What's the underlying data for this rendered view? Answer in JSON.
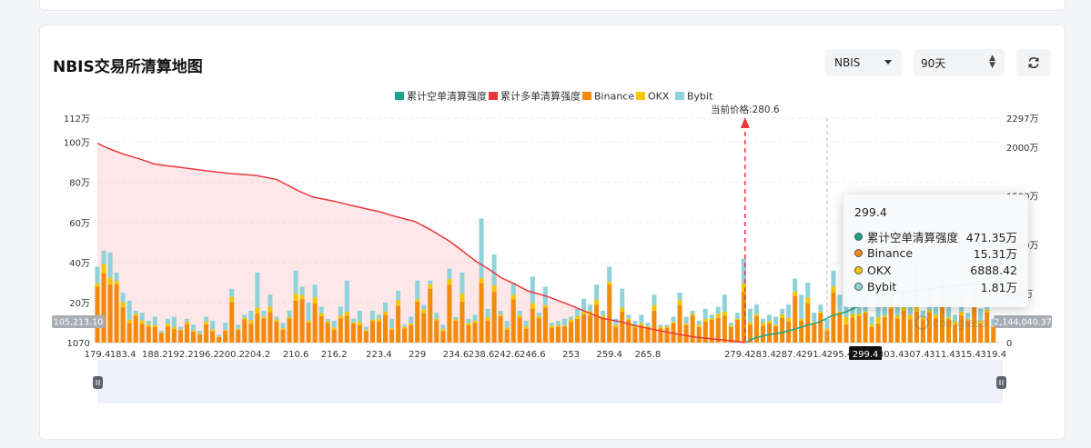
{
  "header": {
    "title": "NBIS交易所清算地图",
    "symbol_select": "NBIS",
    "period_select": "90天"
  },
  "icons": {
    "dropdown": "caret-down-icon",
    "stepper": "up-down-icon",
    "refresh": "refresh-icon"
  },
  "colors": {
    "short_cum": "#1aa48a",
    "long_cum": "#e8383d",
    "binance": "#f28b0c",
    "okx": "#f7c600",
    "bybit": "#8fd3da",
    "price_line": "#e8383d"
  },
  "chart_data": {
    "type": "bar",
    "legend": [
      "累计空单清算强度",
      "累计多单清算强度",
      "Binance",
      "OKX",
      "Bybit"
    ],
    "legend_position": "top-center",
    "current_price_label": "当前价格:280.6",
    "current_price": 280.6,
    "x_range": [
      179.4,
      321
    ],
    "x_ticks": [
      "179.4",
      "183.4",
      "188.2",
      "192.2",
      "196.2",
      "200.2",
      "204.2",
      "210.6",
      "216.2",
      "223.4",
      "229",
      "234.6",
      "238.6",
      "242.6",
      "246.6",
      "253",
      "259.4",
      "265.8",
      "279.4",
      "283.4",
      "287.4",
      "291.4",
      "295.4",
      "299.4",
      "303.4",
      "307.4",
      "311.4",
      "315.4",
      "319.4"
    ],
    "x_tick_values": [
      179.4,
      183.4,
      188.2,
      192.2,
      196.2,
      200.2,
      204.2,
      210.6,
      216.2,
      223.4,
      229,
      234.6,
      238.6,
      242.6,
      246.6,
      253,
      259.4,
      265.8,
      279.4,
      283.4,
      287.4,
      291.4,
      295.4,
      299.4,
      303.4,
      307.4,
      311.4,
      315.4,
      319.4
    ],
    "x_tick_indices": [
      0,
      4,
      9,
      13,
      17,
      21,
      25,
      31,
      37,
      44,
      50,
      56,
      60,
      64,
      68,
      74,
      80,
      86,
      100,
      104,
      108,
      112,
      116,
      120,
      124,
      128,
      132,
      136,
      140
    ],
    "highlight_x": "299.4",
    "left_axis": {
      "ticks": [
        "1070",
        "20万",
        "40万",
        "60万",
        "80万",
        "100万",
        "112万"
      ],
      "tick_values": [
        1070,
        200000,
        400000,
        600000,
        800000,
        1000000,
        1120000
      ],
      "ylim": [
        1070,
        1120000
      ],
      "edge_label": "105,213.10"
    },
    "right_axis": {
      "ticks": [
        "0",
        "500万",
        "1000万",
        "1500万",
        "2000万",
        "2297万"
      ],
      "tick_values": [
        0,
        5000000,
        10000000,
        15000000,
        20000000,
        22970000
      ],
      "ylim": [
        0,
        22970000
      ],
      "edge_label": "2,144,040.37"
    },
    "grid": true,
    "bars": {
      "okx_share_min": 0.04,
      "okx_share_max": 0.12,
      "bybit_share": [
        0.22,
        0.15,
        0.28,
        0.12,
        0.19,
        0.45,
        0.1,
        0.26,
        0.18,
        0.33,
        0.14,
        0.22,
        0.4,
        0.16,
        0.12,
        0.3,
        0.25,
        0.18,
        0.4,
        0.2,
        0.35,
        0.15,
        0.22,
        0.12,
        0.3,
        0.5,
        0.18,
        0.25,
        0.1,
        0.28,
        0.2,
        0.32,
        0.15,
        0.45,
        0.22,
        0.18,
        0.12,
        0.3,
        0.24,
        0.5,
        0.16,
        0.35,
        0.2,
        0.28,
        0.14,
        0.22,
        0.4,
        0.18,
        0.12,
        0.26,
        0.3,
        0.12,
        0.06,
        0.2,
        0.24,
        0.14,
        0.1,
        0.3,
        0.18,
        0.22,
        0.48,
        0.25,
        0.35,
        0.12,
        0.3,
        0.2,
        0.15,
        0.25,
        0.4,
        0.12,
        0.33,
        0.15,
        0.2,
        0.28,
        0.1,
        0.22,
        0.3,
        0.17,
        0.26,
        0.15,
        0.2,
        0.25,
        0.35,
        0.14,
        0.2,
        0.3,
        0.16,
        0.22,
        0.12,
        0.1,
        0.2,
        0.15,
        0.25,
        0.1,
        0.18,
        0.3,
        0.12,
        0.2,
        0.35,
        0.15,
        0.2,
        0.3,
        0.4,
        0.25,
        0.18,
        0.22,
        0.3,
        0.16,
        0.35,
        0.2,
        0.5,
        0.25,
        0.3,
        0.18,
        0.4,
        0.22,
        0.35,
        0.6,
        0.28,
        0.2,
        0.35,
        0.3,
        0.7,
        0.25,
        0.4,
        0.25,
        0.35,
        0.3,
        0.5,
        0.2,
        0.4,
        0.22,
        0.35,
        0.3,
        0.25,
        0.4,
        0.2,
        0.3,
        0.35,
        0.25,
        0.3,
        0.2,
        0.25
      ],
      "total": [
        380000,
        460000,
        450000,
        350000,
        250000,
        210000,
        160000,
        150000,
        110000,
        130000,
        60000,
        120000,
        130000,
        80000,
        120000,
        90000,
        60000,
        130000,
        110000,
        40000,
        100000,
        270000,
        90000,
        140000,
        160000,
        350000,
        160000,
        240000,
        130000,
        100000,
        160000,
        360000,
        280000,
        200000,
        290000,
        180000,
        120000,
        110000,
        180000,
        310000,
        120000,
        160000,
        80000,
        160000,
        140000,
        200000,
        120000,
        260000,
        90000,
        130000,
        310000,
        190000,
        310000,
        150000,
        90000,
        370000,
        130000,
        350000,
        120000,
        140000,
        620000,
        170000,
        440000,
        160000,
        110000,
        300000,
        160000,
        110000,
        330000,
        150000,
        280000,
        100000,
        110000,
        120000,
        130000,
        170000,
        220000,
        190000,
        290000,
        160000,
        380000,
        120000,
        270000,
        140000,
        110000,
        140000,
        100000,
        240000,
        90000,
        90000,
        130000,
        250000,
        130000,
        160000,
        110000,
        170000,
        140000,
        180000,
        240000,
        100000,
        150000,
        420000,
        170000,
        190000,
        120000,
        140000,
        130000,
        170000,
        190000,
        320000,
        240000,
        300000,
        150000,
        190000,
        120000,
        360000,
        240000,
        320000,
        200000,
        180000,
        240000,
        130000,
        420000,
        180000,
        340000,
        180000,
        270000,
        200000,
        380000,
        160000,
        270000,
        180000,
        330000,
        180000,
        140000,
        260000,
        150000,
        300000,
        170000,
        220000,
        120000
      ]
    },
    "long_cum_curve": {
      "x": [
        179.4,
        181,
        183.4,
        186,
        188.2,
        190.2,
        192.2,
        196.2,
        200.2,
        202.2,
        204.2,
        207.4,
        210.6,
        213,
        216.2,
        220,
        223.4,
        226,
        229,
        231.6,
        234.6,
        236.6,
        238.6,
        240.6,
        242.6,
        244.6,
        246.6,
        249.8,
        253,
        255.6,
        258.2,
        261.4,
        263,
        265.8,
        268.2,
        270.6,
        273,
        276,
        278.2,
        280.6
      ],
      "y": [
        20400000,
        19900000,
        19300000,
        18800000,
        18300000,
        18100000,
        17950000,
        17600000,
        17300000,
        17200000,
        17100000,
        16700000,
        15600000,
        14900000,
        14500000,
        13900000,
        13400000,
        12900000,
        12400000,
        11500000,
        10300000,
        9300000,
        8300000,
        7500000,
        6600000,
        6000000,
        5300000,
        4700000,
        3900000,
        3200000,
        2500000,
        2100000,
        1800000,
        1400000,
        1100000,
        800000,
        550000,
        350000,
        200000,
        0
      ]
    },
    "short_cum_curve": {
      "x": [
        280.6,
        282.2,
        284.2,
        286.2,
        288.2,
        290.2,
        292.2,
        294.2,
        296.2,
        298.2,
        299.4,
        301.4,
        303.4,
        305.4,
        307.4,
        309.4,
        311.4,
        313.4,
        315.4,
        317.4,
        319.4,
        321
      ],
      "y": [
        0,
        500000,
        800000,
        1000000,
        1350000,
        1750000,
        2100000,
        2750000,
        3100000,
        3700000,
        4713500,
        4900000,
        5050000,
        5200000,
        5350000,
        5500000,
        5650000,
        5800000,
        5950000,
        6050000,
        6150000,
        6250000
      ]
    },
    "tooltip": {
      "title": "299.4",
      "rows": [
        {
          "name": "累计空单清算强度",
          "value": "471.35万",
          "color": "#1aa48a"
        },
        {
          "name": "Binance",
          "value": "15.31万",
          "color": "#f28b0c"
        },
        {
          "name": "OKX",
          "value": "6888.42",
          "color": "#f7c600"
        },
        {
          "name": "Bybit",
          "value": "1.81万",
          "color": "#8fd3da"
        }
      ]
    }
  }
}
